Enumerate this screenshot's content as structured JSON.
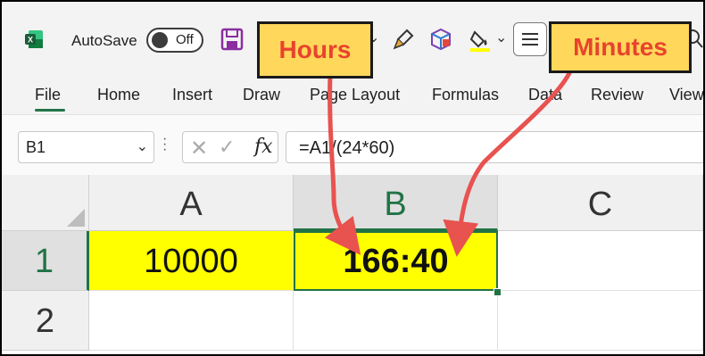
{
  "titlebar": {
    "autosave_label": "AutoSave",
    "toggle_state": "Off"
  },
  "ribbon": {
    "tabs": [
      "File",
      "Home",
      "Insert",
      "Draw",
      "Page Layout",
      "Formulas",
      "Data",
      "Review",
      "View"
    ],
    "active_tab": "File"
  },
  "formula_bar": {
    "name_box": "B1",
    "formula": "=A1/(24*60)"
  },
  "sheet": {
    "columns": [
      "A",
      "B",
      "C"
    ],
    "rows": [
      "1",
      "2"
    ],
    "cells": {
      "A1": "10000",
      "B1": "166:40"
    },
    "selected_cell": "B1"
  },
  "annotations": {
    "hours": "Hours",
    "minutes": "Minutes"
  },
  "colors": {
    "excel_green": "#217346",
    "highlight_yellow": "#ffff00",
    "callout_fill": "#ffd75a",
    "arrow_red": "#e8524f"
  },
  "icons": [
    "excel-logo-icon",
    "save-icon",
    "format-painter-icon",
    "cube-icon",
    "fill-color-icon",
    "menu-icon",
    "search-icon"
  ]
}
